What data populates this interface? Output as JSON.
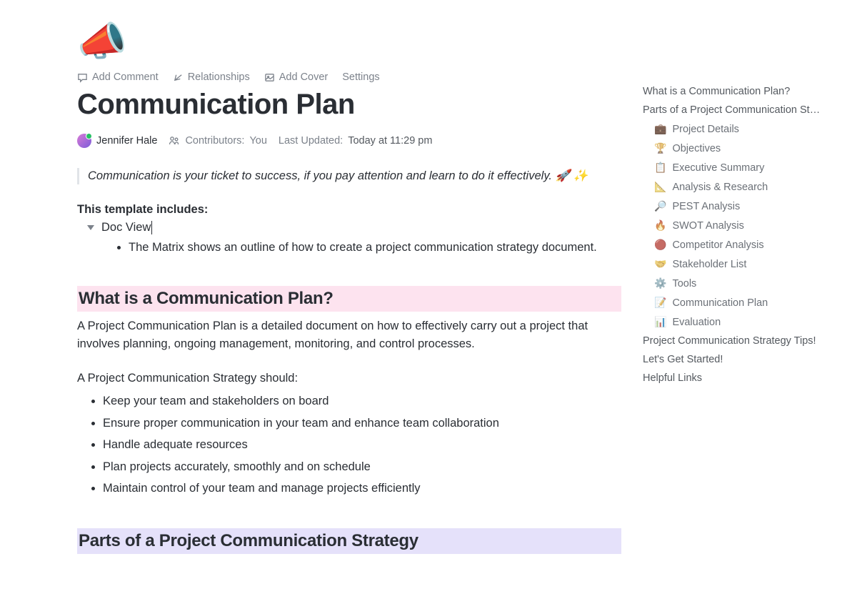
{
  "hero_icon": "📣",
  "toolbar": {
    "add_comment": "Add Comment",
    "relationships": "Relationships",
    "add_cover": "Add Cover",
    "settings": "Settings"
  },
  "title": "Communication Plan",
  "author": "Jennifer Hale",
  "contributors_label": "Contributors:",
  "contributors_value": "You",
  "updated_label": "Last Updated:",
  "updated_value": "Today at 11:29 pm",
  "quote": "Communication is your ticket to success, if you pay attention and learn to do it effectively. 🚀 ✨",
  "includes_heading": "This template includes:",
  "doc_view_label": "Doc View",
  "doc_view_bullets": [
    "The Matrix shows an outline of how to create a project communication strategy document."
  ],
  "section1_heading": "What is a Communication Plan?",
  "section1_para": "A Project Communication Plan is a detailed document on how to effectively carry out a project that involves planning, ongoing management, monitoring, and control processes.",
  "strategy_intro": "A Project Communication Strategy should:",
  "strategy_items": [
    "Keep your team and stakeholders on board",
    "Ensure proper communication in your team and enhance team collaboration",
    "Handle adequate resources",
    "Plan projects accurately, smoothly and on schedule",
    "Maintain control of your team and manage projects efficiently"
  ],
  "section2_heading": "Parts of a Project Communication Strategy",
  "toc": {
    "top": [
      "What is a Communication Plan?",
      "Parts of a Project Communication St…"
    ],
    "sub": [
      {
        "emoji": "💼",
        "label": "Project Details"
      },
      {
        "emoji": "🏆",
        "label": "Objectives"
      },
      {
        "emoji": "📋",
        "label": "Executive Summary"
      },
      {
        "emoji": "📐",
        "label": "Analysis & Research"
      },
      {
        "emoji": "🔎",
        "label": "PEST Analysis"
      },
      {
        "emoji": "🔥",
        "label": "SWOT Analysis"
      },
      {
        "emoji": "🔴",
        "label": "Competitor Analysis"
      },
      {
        "emoji": "🤝",
        "label": "Stakeholder List"
      },
      {
        "emoji": "⚙️",
        "label": "Tools"
      },
      {
        "emoji": "📝",
        "label": "Communication Plan"
      },
      {
        "emoji": "📊",
        "label": "Evaluation"
      }
    ],
    "bottom": [
      "Project Communication Strategy Tips!",
      "Let's Get Started!",
      "Helpful Links"
    ]
  }
}
